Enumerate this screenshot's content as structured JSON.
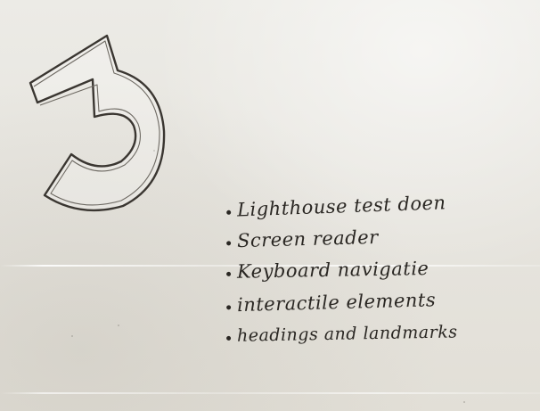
{
  "whiteboard": {
    "digit": "3",
    "notes": [
      "Lighthouse test doen",
      "Screen reader",
      "Keyboard navigatie",
      "interactile elements",
      "headings and landmarks"
    ]
  },
  "colors": {
    "board": "#e6e3db",
    "ink": "#2a2723"
  }
}
